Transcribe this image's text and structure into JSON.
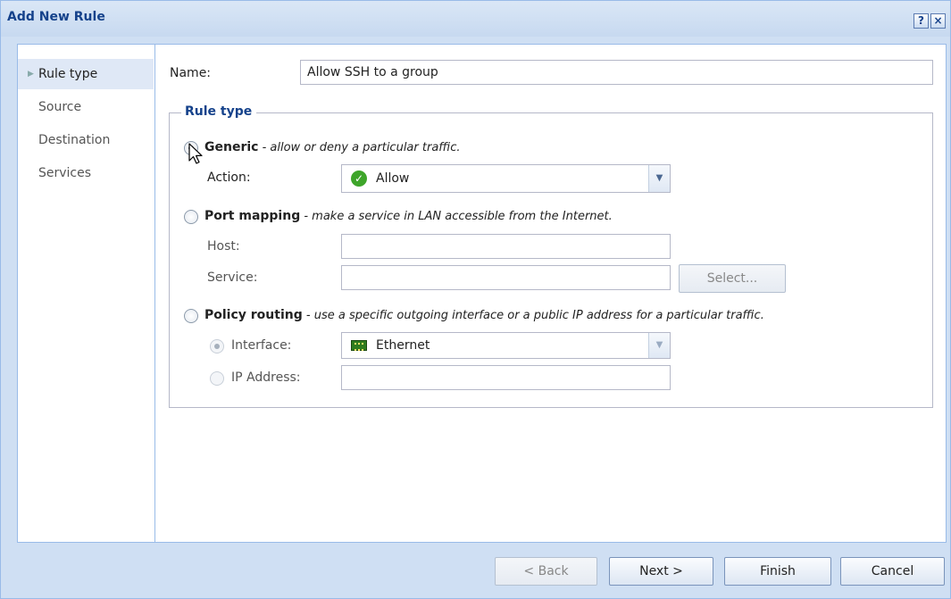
{
  "window": {
    "title": "Add New Rule",
    "help_label": "?",
    "close_label": "×"
  },
  "sidebar": {
    "items": [
      {
        "label": "Rule type",
        "active": true
      },
      {
        "label": "Source"
      },
      {
        "label": "Destination"
      },
      {
        "label": "Services"
      }
    ]
  },
  "form": {
    "name_label": "Name:",
    "name_value": "Allow SSH to a group",
    "ruletype_legend": "Rule type",
    "generic": {
      "title": "Generic",
      "desc": " - allow or deny a particular traffic.",
      "action_label": "Action:",
      "action_value": "Allow"
    },
    "port_mapping": {
      "title": "Port mapping",
      "desc": " - make a service in LAN accessible from the Internet.",
      "host_label": "Host:",
      "service_label": "Service:",
      "select_label": "Select..."
    },
    "policy_routing": {
      "title": "Policy routing",
      "desc": " - use a specific outgoing interface or a public IP address for a particular traffic.",
      "interface_label": "Interface:",
      "interface_value": "Ethernet",
      "ip_label": "IP Address:"
    }
  },
  "footer": {
    "back": "< Back",
    "next": "Next >",
    "finish": "Finish",
    "cancel": "Cancel"
  },
  "icons": {
    "action": "check-circle-icon",
    "interface": "network-card-icon"
  },
  "colors": {
    "title": "#15428b",
    "border": "#99bbe8",
    "dialog_bg": "#cfdff3",
    "allow_green": "#3ea52a"
  }
}
